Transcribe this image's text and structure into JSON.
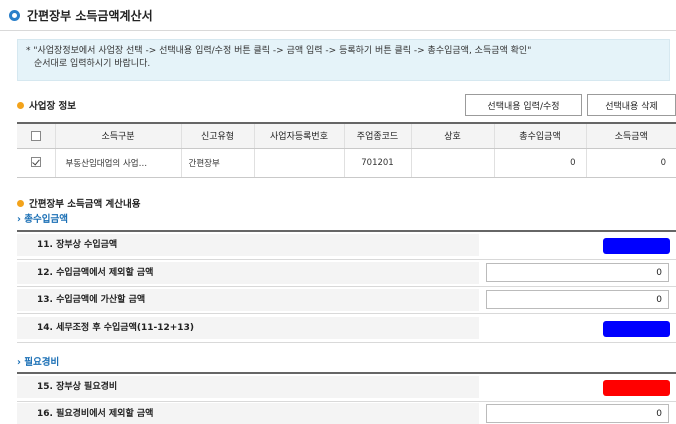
{
  "header": {
    "title": "간편장부 소득금액계산서"
  },
  "notice": {
    "line1": "* \"사업장정보에서 사업장 선택 -> 선택내용 입력/수정 버튼 클릭 -> 금액 입력 -> 등록하기 버튼 클릭 -> 총수입금액, 소득금액 확인\"",
    "line2": "순서대로 입력하시기 바랍니다."
  },
  "business": {
    "title": "사업장 정보",
    "edit_button": "선택내용 입력/수정",
    "delete_button": "선택내용 삭제",
    "columns": [
      "",
      "소득구분",
      "신고유형",
      "사업자등록번호",
      "주업종코드",
      "상호",
      "총수입금액",
      "소득금액"
    ],
    "rows": [
      {
        "checked": true,
        "income_type": "부동산임대업의 사업…",
        "report_type": "간편장부",
        "reg_no": "",
        "industry_code": "701201",
        "trade_name": "",
        "total_revenue": "0",
        "income_amount": "0"
      }
    ]
  },
  "calc": {
    "title": "간편장부 소득금액 계산내용",
    "revenue_section": {
      "label": "총수입금액",
      "rows": [
        {
          "label": "11. 장부상 수입금액",
          "kind": "swatch",
          "color": "#0000ff"
        },
        {
          "label": "12. 수입금액에서 제외할 금액",
          "kind": "input",
          "value": "0"
        },
        {
          "label": "13. 수입금액에 가산할 금액",
          "kind": "input",
          "value": "0"
        },
        {
          "label": "14. 세무조정 후 수입금액(11-12+13)",
          "kind": "swatch",
          "color": "#0000ff"
        }
      ]
    },
    "expense_section": {
      "label": "필요경비",
      "rows": [
        {
          "label": "15. 장부상 필요경비",
          "kind": "swatch",
          "color": "#ff0000"
        },
        {
          "label": "16. 필요경비에서 제외할 금액",
          "kind": "input",
          "value": "0"
        }
      ]
    }
  },
  "colors": {
    "accent": "#2a7fc9",
    "section_dot": "#f3a31b",
    "sub_heading": "#1a6fb5",
    "notice_bg": "#e5f3f9"
  }
}
